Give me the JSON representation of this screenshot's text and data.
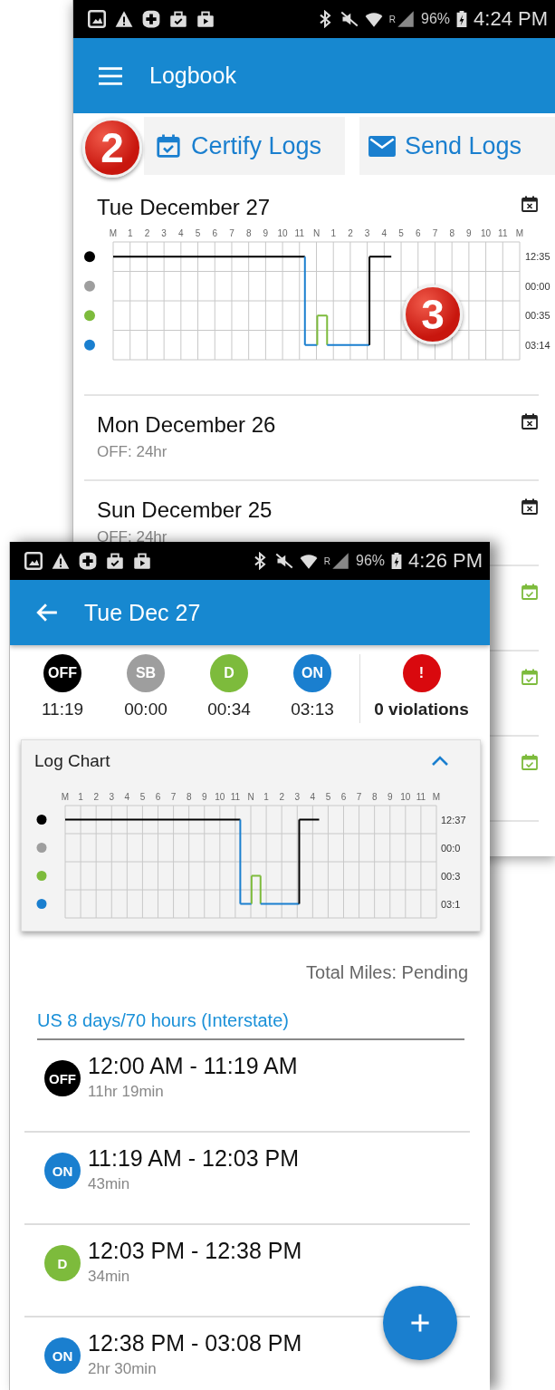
{
  "logbook_screen": {
    "status_bar": {
      "roaming": "R",
      "battery": "96%",
      "time": "4:24 PM"
    },
    "app_bar": {
      "title": "Logbook"
    },
    "actions": [
      {
        "label": "Certify Logs",
        "kind": "certify"
      },
      {
        "label": "Send Logs",
        "kind": "send"
      }
    ],
    "callouts": [
      "2",
      "3"
    ],
    "days": [
      {
        "title": "Tue  December 27",
        "certified": false,
        "duty_graph": {
          "hour_labels": [
            "M",
            "1",
            "2",
            "3",
            "4",
            "5",
            "6",
            "7",
            "8",
            "9",
            "10",
            "11",
            "N",
            "1",
            "2",
            "3",
            "4",
            "5",
            "6",
            "7",
            "8",
            "9",
            "10",
            "11",
            "M"
          ],
          "lane_totals": [
            "12:35",
            "00:00",
            "00:35",
            "03:14"
          ]
        }
      },
      {
        "title": "Mon  December 26",
        "summary": "OFF: 24hr",
        "certified": false
      },
      {
        "title": "Sun  December 25",
        "summary": "OFF: 24hr",
        "certified": false
      },
      {
        "certified": true
      },
      {
        "certified": true
      },
      {
        "certified": true
      }
    ]
  },
  "detail_screen": {
    "status_bar": {
      "roaming": "R",
      "battery": "96%",
      "time": "4:26 PM"
    },
    "app_bar": {
      "title": "Tue Dec 27"
    },
    "summary": [
      {
        "code": "OFF",
        "color": "#000000",
        "total": "11:19"
      },
      {
        "code": "SB",
        "color": "#9e9e9e",
        "total": "00:00"
      },
      {
        "code": "D",
        "color": "#7dbb3c",
        "total": "00:34"
      },
      {
        "code": "ON",
        "color": "#1a7fcf",
        "total": "03:13"
      }
    ],
    "violations": {
      "icon": "!",
      "label": "0 violations"
    },
    "log_chart": {
      "title": "Log Chart",
      "expanded": true,
      "duty_graph": {
        "hour_labels": [
          "M",
          "1",
          "2",
          "3",
          "4",
          "5",
          "6",
          "7",
          "8",
          "9",
          "10",
          "11",
          "N",
          "1",
          "2",
          "3",
          "4",
          "5",
          "6",
          "7",
          "8",
          "9",
          "10",
          "11",
          "M"
        ],
        "lane_totals": [
          "12:37",
          "00:0",
          "00:3",
          "03:1"
        ]
      }
    },
    "total_miles": "Total Miles: Pending",
    "ruleset": "US 8 days/70 hours (Interstate)",
    "events": [
      {
        "status": "OFF",
        "color": "#000000",
        "range": "12:00 AM - 11:19 AM",
        "duration": "11hr 19min"
      },
      {
        "status": "ON",
        "color": "#1a7fcf",
        "range": "11:19 AM - 12:03 PM",
        "duration": "43min"
      },
      {
        "status": "D",
        "color": "#7dbb3c",
        "range": "12:03 PM - 12:38 PM",
        "duration": "34min"
      },
      {
        "status": "ON",
        "color": "#1a7fcf",
        "range": "12:38 PM - 03:08 PM",
        "duration": "2hr 30min"
      }
    ]
  }
}
